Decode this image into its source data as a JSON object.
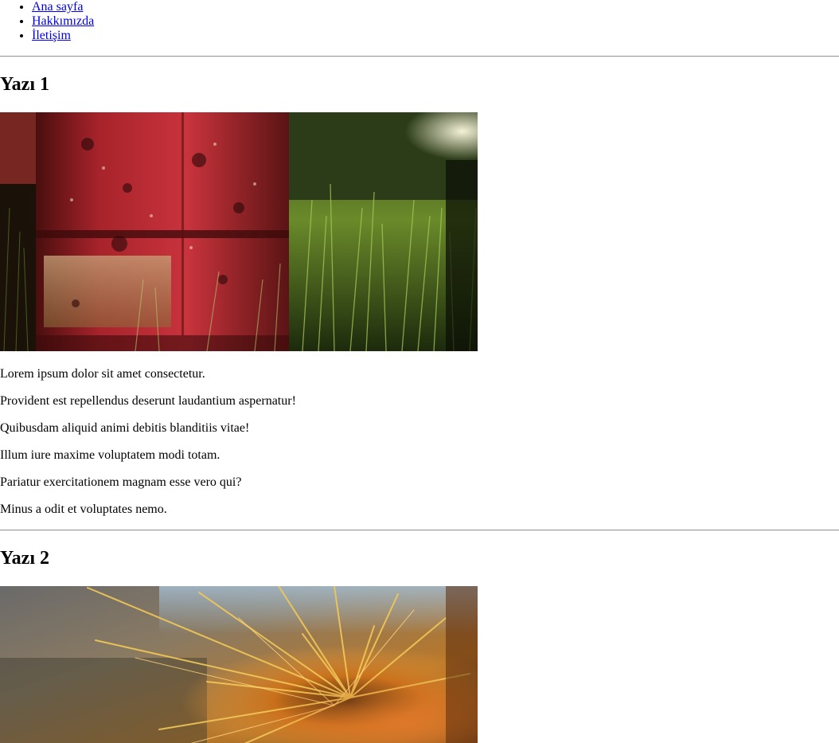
{
  "nav": {
    "items": [
      {
        "label": "Ana sayfa"
      },
      {
        "label": "Hakkımızda"
      },
      {
        "label": "İletişim"
      }
    ]
  },
  "posts": [
    {
      "title": "Yazı 1",
      "image_subject": "rusty-red-barrel-in-tall-grass",
      "paragraphs": [
        "Lorem ipsum dolor sit amet consectetur.",
        "Provident est repellendus deserunt laudantium aspernatur!",
        "Quibusdam aliquid animi debitis blanditiis vitae!",
        "Illum iure maxime voluptatem modi totam.",
        "Pariatur exercitationem magnam esse vero qui?",
        "Minus a odit et voluptates nemo."
      ]
    },
    {
      "title": "Yazı 2",
      "image_subject": "orange-cactus-spines-closeup"
    }
  ]
}
